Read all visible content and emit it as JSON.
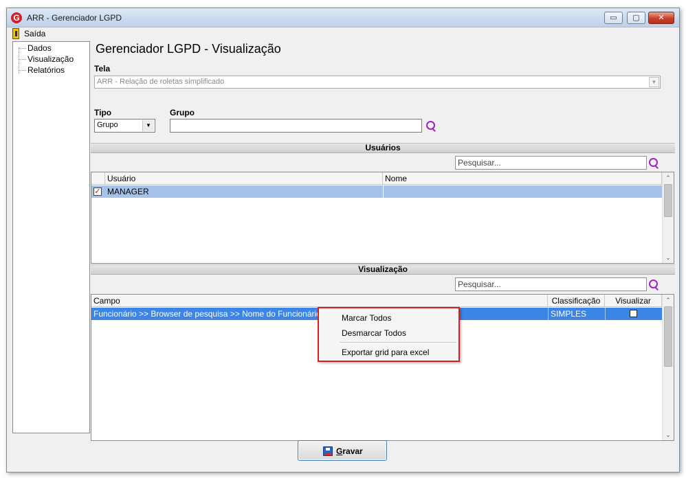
{
  "window": {
    "title": "ARR - Gerenciador LGPD",
    "logo_letter": "G",
    "minimize": "▭",
    "maximize": "▢",
    "close": "✕"
  },
  "menu": {
    "exit_label": "Saída"
  },
  "tree": {
    "items": [
      "Dados",
      "Visualização",
      "Relatórios"
    ]
  },
  "page": {
    "title": "Gerenciador LGPD - Visualização",
    "tela_label": "Tela",
    "tela_value": "ARR -  Relação de roletas simplificado",
    "tipo_label": "Tipo",
    "tipo_value": "Grupo",
    "grupo_label": "Grupo",
    "grupo_value": ""
  },
  "usuarios": {
    "header": "Usuários",
    "search_placeholder": "Pesquisar...",
    "columns": [
      "Usuário",
      "Nome"
    ],
    "rows": [
      {
        "checked": true,
        "usuario": "MANAGER",
        "nome": ""
      }
    ]
  },
  "visualizacao": {
    "header": "Visualização",
    "search_placeholder": "Pesquisar...",
    "columns": [
      "Campo",
      "Classificação",
      "Visualizar"
    ],
    "rows": [
      {
        "campo": "Funcionário >> Browser de pesquisa >> Nome do Funcionário",
        "classificacao": "SIMPLES",
        "visualizar": false
      }
    ]
  },
  "context_menu": {
    "items": [
      "Marcar Todos",
      "Desmarcar Todos",
      "Exportar grid para excel"
    ]
  },
  "footer": {
    "save_mnemonic": "G",
    "save_rest": "ravar"
  },
  "colors": {
    "selection_blue": "#3a85e6",
    "selection_light": "#a7c2e8",
    "highlight_border": "#d42020",
    "search_icon": "#a020c0"
  }
}
